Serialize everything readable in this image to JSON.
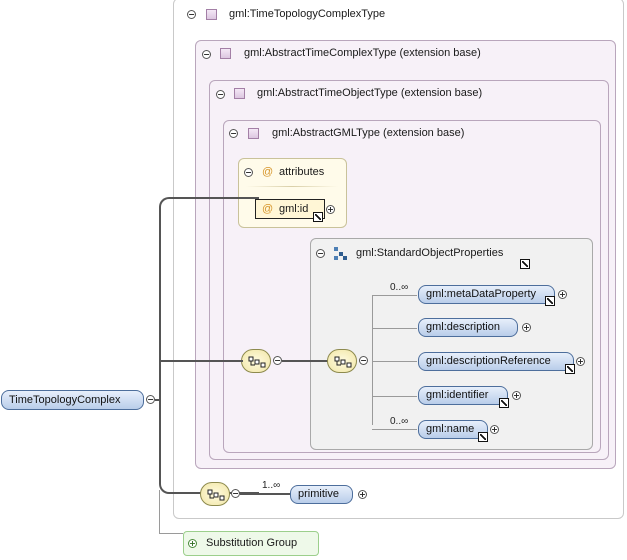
{
  "root_element": "TimeTopologyComplex",
  "type_box": {
    "title": "gml:TimeTopologyComplexType",
    "level1": {
      "title": "gml:AbstractTimeComplexType (extension base)",
      "level2": {
        "title": "gml:AbstractTimeObjectType (extension base)",
        "level3": {
          "title": "gml:AbstractGMLType (extension base)",
          "attributes": {
            "title": "attributes",
            "at_symbol": "@",
            "items": [
              "gml:id"
            ]
          },
          "group": {
            "title": "gml:StandardObjectProperties",
            "elements": [
              {
                "name": "gml:metaDataProperty",
                "multiplicity": "0..∞"
              },
              {
                "name": "gml:description",
                "multiplicity": ""
              },
              {
                "name": "gml:descriptionReference",
                "multiplicity": ""
              },
              {
                "name": "gml:identifier",
                "multiplicity": ""
              },
              {
                "name": "gml:name",
                "multiplicity": "0..∞"
              }
            ]
          }
        }
      }
    },
    "sequence_element": {
      "name": "primitive",
      "multiplicity": "1..∞"
    }
  },
  "substitution_group": {
    "label": "Substitution Group"
  },
  "colors": {
    "type_box_border": "#c9c9c9",
    "ext_box_bg": "#f7f1f8",
    "ext_box_border": "#b9a6bc",
    "group_box_bg": "#f1f1f1",
    "attr_bg": "#fffbea",
    "substitution_bg": "#eef9e9"
  }
}
